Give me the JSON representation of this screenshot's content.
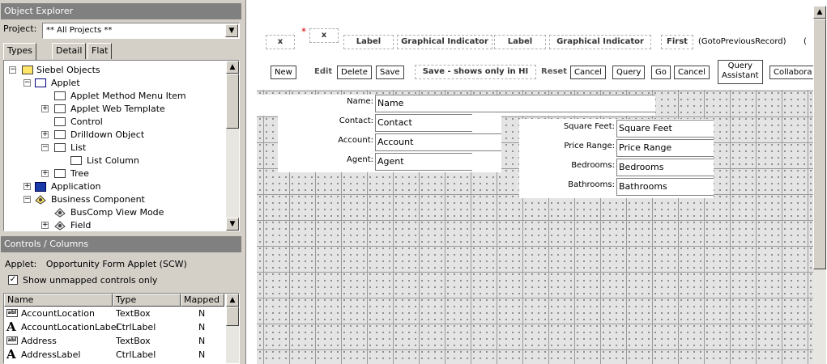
{
  "object_explorer": {
    "title": "Object Explorer",
    "project_label": "Project:",
    "project_value": "** All Projects **",
    "tabs": [
      "Types",
      "Detail",
      "Flat"
    ],
    "tree": [
      {
        "label": "Siebel Objects",
        "expander": "−"
      },
      {
        "label": "Applet",
        "expander": "−"
      },
      {
        "label": "Applet Method Menu Item"
      },
      {
        "label": "Applet Web Template",
        "expander": "+"
      },
      {
        "label": "Control"
      },
      {
        "label": "Drilldown Object",
        "expander": "+"
      },
      {
        "label": "List",
        "expander": "−"
      },
      {
        "label": "List Column"
      },
      {
        "label": "Tree",
        "expander": "+"
      },
      {
        "label": "Application",
        "expander": "+"
      },
      {
        "label": "Business Component",
        "expander": "−"
      },
      {
        "label": "BusComp View Mode"
      },
      {
        "label": "Field",
        "expander": "+"
      }
    ]
  },
  "controls_columns": {
    "title": "Controls / Columns",
    "applet_label": "Applet:",
    "applet_value": "Opportunity Form Applet (SCW)",
    "show_unmapped_label": "Show unmapped controls only",
    "show_unmapped_checked": "✓",
    "columns": [
      "Name",
      "Type",
      "Mapped"
    ],
    "rows": [
      {
        "icon": "textbox-icon",
        "name": "AccountLocation",
        "type": "TextBox",
        "mapped": "N"
      },
      {
        "icon": "label-icon",
        "name": "AccountLocationLabel",
        "type": "CtrlLabel",
        "mapped": "N"
      },
      {
        "icon": "textbox-icon",
        "name": "Address",
        "type": "TextBox",
        "mapped": "N"
      },
      {
        "icon": "label-icon",
        "name": "AddressLabel",
        "type": "CtrlLabel",
        "mapped": "N"
      }
    ]
  },
  "designer": {
    "top_row": {
      "x1": "x",
      "star": "*",
      "x2": "x",
      "label1": "Label",
      "graph1": "Graphical Indicator",
      "label2": "Label",
      "graph2": "Graphical Indicator",
      "first": "First",
      "goto_prev": "(GotoPreviousRecord)",
      "paren": "("
    },
    "buttons": {
      "new": "New",
      "edit": "Edit",
      "delete": "Delete",
      "save": "Save",
      "save_hi": "Save - shows only in HI",
      "reset": "Reset",
      "cancel1": "Cancel",
      "query": "Query",
      "go": "Go",
      "cancel2": "Cancel",
      "query_assistant_1": "Query",
      "query_assistant_2": "Assistant",
      "collaborate": "Collabora"
    },
    "form_left": [
      {
        "label": "Name:",
        "value": "Name"
      },
      {
        "label": "Contact:",
        "value": "Contact"
      },
      {
        "label": "Account:",
        "value": "Account"
      },
      {
        "label": "Agent:",
        "value": "Agent"
      }
    ],
    "form_right": [
      {
        "label": "Square Feet:",
        "value": "Square Feet"
      },
      {
        "label": "Price Range:",
        "value": "Price Range"
      },
      {
        "label": "Bedrooms:",
        "value": "Bedrooms"
      },
      {
        "label": "Bathrooms:",
        "value": "Bathrooms"
      }
    ]
  },
  "colors": {
    "pane_title_bg": "#808080",
    "window_bg": "#d4d0c8",
    "required_star": "#d00000"
  }
}
